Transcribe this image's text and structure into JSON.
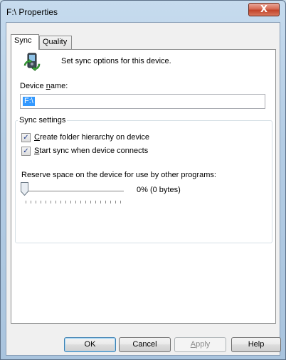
{
  "window": {
    "title": "F:\\ Properties",
    "close_glyph": "X"
  },
  "tabs": [
    {
      "label": "Sync",
      "active": true
    },
    {
      "label": "Quality",
      "active": false
    }
  ],
  "sync_page": {
    "icon": "sync-device-icon",
    "intro": "Set sync options for this device.",
    "device_name": {
      "label_pre": "Device ",
      "label_accel": "n",
      "label_post": "ame:",
      "value": "F:\\"
    },
    "sync_settings": {
      "legend": "Sync settings",
      "create_folder": {
        "accel": "C",
        "rest": "reate folder hierarchy on device",
        "checked": true
      },
      "start_sync": {
        "accel": "S",
        "rest": "tart sync when device connects",
        "checked": true
      },
      "reserve_label": "Reserve space on the device for use by other programs:",
      "reserve_value": 0,
      "reserve_text": "0% (0 bytes)"
    }
  },
  "buttons": {
    "ok": "OK",
    "cancel": "Cancel",
    "apply_accel": "A",
    "apply_rest": "pply",
    "help": "Help"
  },
  "colors": {
    "selection": "#3399ff",
    "close_button": "#c2432a"
  }
}
